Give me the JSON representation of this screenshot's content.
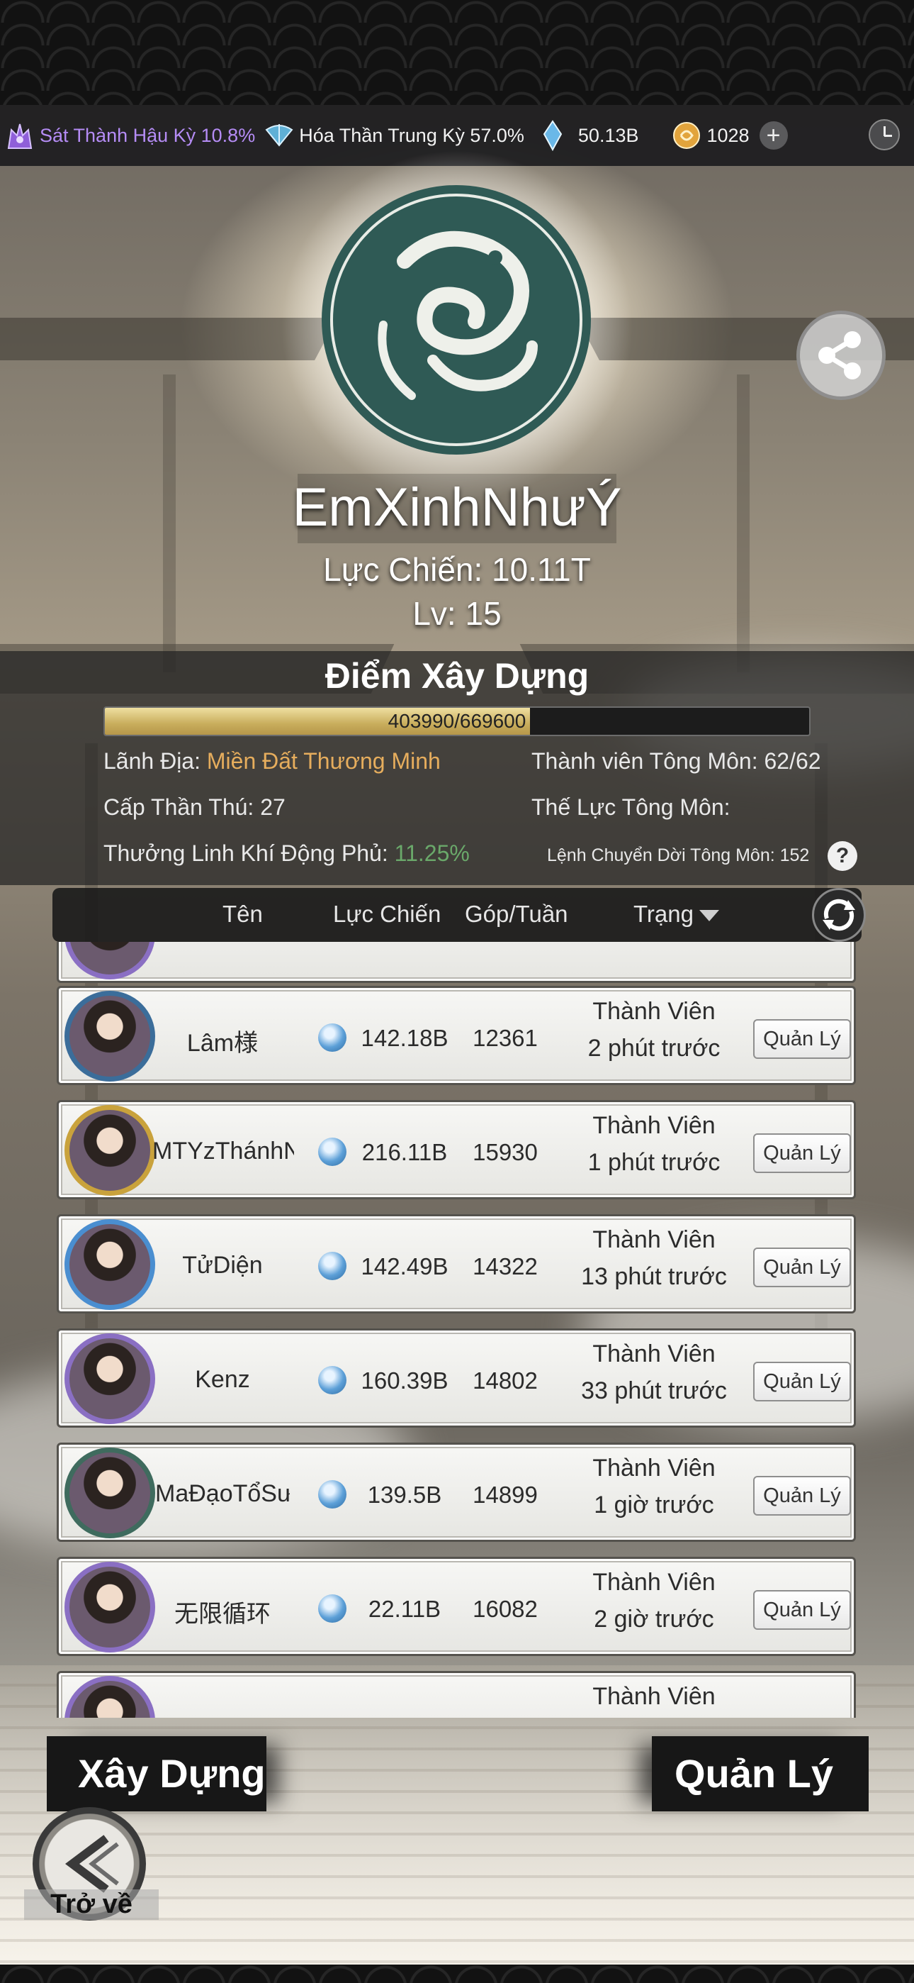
{
  "status_bar": {
    "realm1": "Sát Thành Hậu Kỳ 10.8%",
    "realm2": "Hóa Thần Trung Kỳ 57.0%",
    "crystals": "50.13B",
    "gold": "1028",
    "plus_symbol": "+"
  },
  "guild": {
    "name": "EmXinhNhưÝ",
    "power": "Lực Chiến: 10.11T",
    "level": "Lv: 15"
  },
  "build": {
    "title": "Điểm Xây Dựng",
    "progress_text": "403990/669600",
    "current": 403990,
    "max": 669600
  },
  "info": {
    "territory_label": "Lãnh Địa:",
    "territory_value": "Miền Đất Thương Minh",
    "members": "Thành viên Tông Môn: 62/62",
    "beast_level": "Cấp Thần Thú: 27",
    "faction": "Thế Lực Tông Môn:",
    "bonus_label": "Thưởng Linh Khí Động Phủ:",
    "bonus_value": "11.25%",
    "transfer": "Lệnh Chuyển Dời Tông Môn: 152",
    "help": "?"
  },
  "table": {
    "col_name": "Tên",
    "col_power": "Lực Chiến",
    "col_contrib": "Góp/Tuần",
    "col_status": "Trạng"
  },
  "members": [
    {
      "name": "",
      "power": "",
      "contrib": "",
      "role": "",
      "time": "",
      "manage": ""
    },
    {
      "name": "Lâm様",
      "power": "142.18B",
      "contrib": "12361",
      "role": "Thành Viên",
      "time": "2 phút trước",
      "manage": "Quản Lý"
    },
    {
      "name": "MTYzThánhNho",
      "power": "216.11B",
      "contrib": "15930",
      "role": "Thành Viên",
      "time": "1 phút trước",
      "manage": "Quản Lý"
    },
    {
      "name": "TửDiện",
      "power": "142.49B",
      "contrib": "14322",
      "role": "Thành Viên",
      "time": "13 phút trước",
      "manage": "Quản Lý"
    },
    {
      "name": "Kenz",
      "power": "160.39B",
      "contrib": "14802",
      "role": "Thành Viên",
      "time": "33 phút trước",
      "manage": "Quản Lý"
    },
    {
      "name": "MaĐạoTổSư",
      "power": "139.5B",
      "contrib": "14899",
      "role": "Thành Viên",
      "time": "1 giờ trước",
      "manage": "Quản Lý"
    },
    {
      "name": "无限循环",
      "power": "22.11B",
      "contrib": "16082",
      "role": "Thành Viên",
      "time": "2 giờ trước",
      "manage": "Quản Lý"
    },
    {
      "name": "",
      "power": "",
      "contrib": "",
      "role": "Thành Viên",
      "time": "",
      "manage": ""
    }
  ],
  "bottom": {
    "build_button": "Xây Dựng",
    "manage_button": "Quản Lý",
    "back_label": "Trở về"
  },
  "colors": {
    "realm_purple": "#b58cf5",
    "territory_gold": "#e6ad5d",
    "bonus_green": "#6aa86a",
    "progress_gold": "#c8ad5c"
  }
}
